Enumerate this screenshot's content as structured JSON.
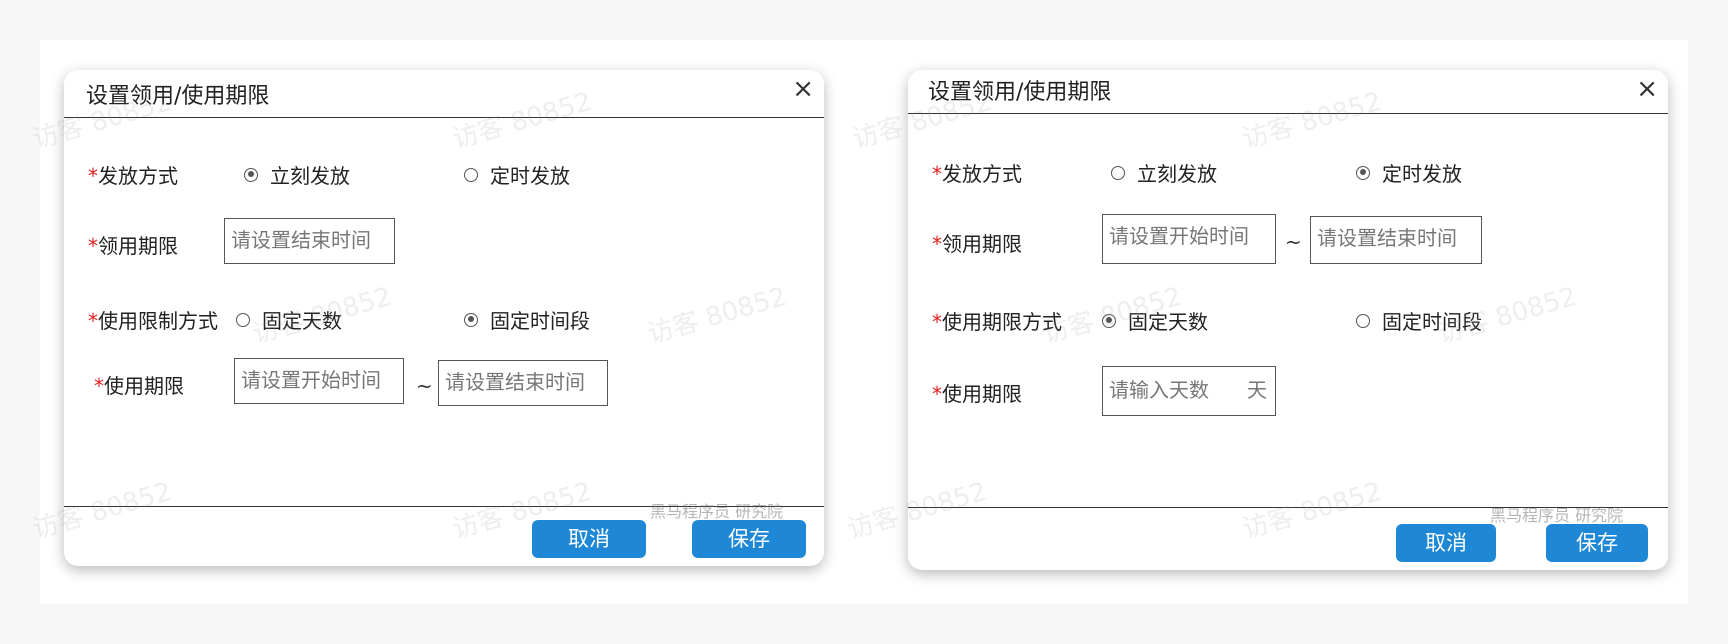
{
  "dialog_a": {
    "title": "设置领用/使用期限",
    "close": "×",
    "issue_method": {
      "star": "*",
      "label": "发放方式",
      "options": [
        "立刻发放",
        "定时发放"
      ],
      "selected": 0
    },
    "claim_period": {
      "star": "*",
      "label": "领用期限",
      "end_placeholder": "请设置结束时间"
    },
    "usage_limit_method": {
      "star": "*",
      "label": "使用限制方式",
      "options": [
        "固定天数",
        "固定时间段"
      ],
      "selected": 1
    },
    "usage_period": {
      "star": "*",
      "label": "使用期限",
      "start_placeholder": "请设置开始时间",
      "tilde": "~",
      "end_placeholder": "请设置结束时间"
    },
    "cancel": "取消",
    "save": "保存"
  },
  "dialog_b": {
    "title": "设置领用/使用期限",
    "close": "×",
    "issue_method": {
      "star": "*",
      "label": "发放方式",
      "options": [
        "立刻发放",
        "定时发放"
      ],
      "selected": 1
    },
    "claim_period": {
      "star": "*",
      "label": "领用期限",
      "start_placeholder": "请设置开始时间",
      "tilde": "~",
      "end_placeholder": "请设置结束时间"
    },
    "usage_period_method": {
      "star": "*",
      "label": "使用期限方式",
      "options": [
        "固定天数",
        "固定时间段"
      ],
      "selected": 0
    },
    "usage_period": {
      "star": "*",
      "label": "使用期限",
      "days_placeholder": "请输入天数",
      "unit": "天"
    },
    "cancel": "取消",
    "save": "保存"
  },
  "watermarks": {
    "visitor": "访客 80852",
    "brand": "黑马程序员 研究院"
  }
}
